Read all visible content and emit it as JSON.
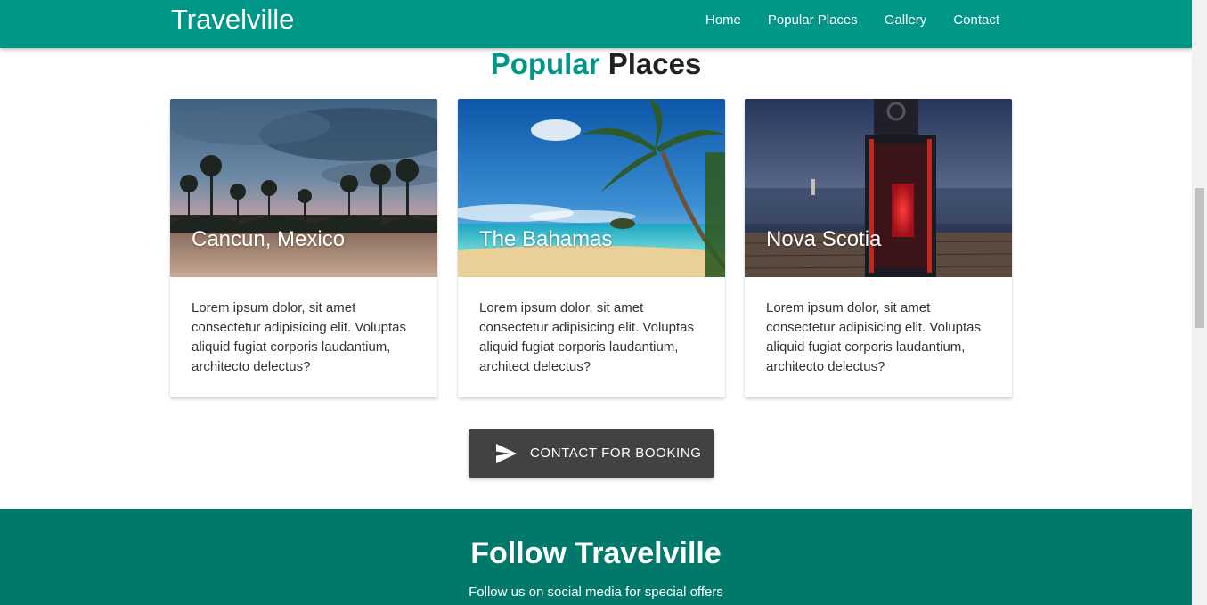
{
  "brand": "Travelville",
  "nav": {
    "items": [
      {
        "label": "Home"
      },
      {
        "label": "Popular Places"
      },
      {
        "label": "Gallery"
      },
      {
        "label": "Contact"
      }
    ]
  },
  "section": {
    "title_accent": "Popular",
    "title_rest": "Places"
  },
  "cards": [
    {
      "title": "Cancun, Mexico",
      "text": "Lorem ipsum dolor, sit amet consectetur adipisicing elit. Voluptas aliquid fugiat corporis laudantium, architecto delectus?"
    },
    {
      "title": "The Bahamas",
      "text": "Lorem ipsum dolor, sit amet consectetur adipisicing elit. Voluptas aliquid fugiat corporis laudantium, architect delectus?"
    },
    {
      "title": "Nova Scotia",
      "text": "Lorem ipsum dolor, sit amet consectetur adipisicing elit. Voluptas aliquid fugiat corporis laudantium, architecto delectus?"
    }
  ],
  "cta": {
    "label": "CONTACT FOR BOOKING",
    "icon": "send-icon"
  },
  "follow": {
    "title": "Follow Travelville",
    "subtitle": "Follow us on social media for special offers"
  },
  "colors": {
    "primary": "#009688",
    "primary_dark": "#00796b",
    "button": "#424242"
  }
}
